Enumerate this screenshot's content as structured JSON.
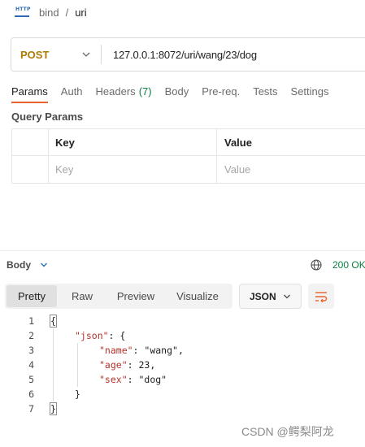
{
  "breadcrumb": {
    "icon": "http-icon",
    "icon_text": "HTTP",
    "parent": "bind",
    "separator": "/",
    "current": "uri"
  },
  "request": {
    "method": "POST",
    "url": "127.0.0.1:8072/uri/wang/23/dog"
  },
  "tabs": [
    {
      "label": "Params",
      "active": true
    },
    {
      "label": "Auth"
    },
    {
      "label": "Headers",
      "count": "(7)"
    },
    {
      "label": "Body"
    },
    {
      "label": "Pre-req."
    },
    {
      "label": "Tests"
    },
    {
      "label": "Settings"
    }
  ],
  "query_params": {
    "title": "Query Params",
    "columns": [
      "Key",
      "Value"
    ],
    "placeholder_row": [
      "Key",
      "Value"
    ]
  },
  "response": {
    "body_label": "Body",
    "status": "200 OK",
    "view_modes": [
      "Pretty",
      "Raw",
      "Preview",
      "Visualize"
    ],
    "active_view": "Pretty",
    "format": "JSON",
    "code_lines": [
      {
        "num": "1",
        "text": "{"
      },
      {
        "num": "2",
        "text": "\"json\": {"
      },
      {
        "num": "3",
        "text": "\"name\": \"wang\","
      },
      {
        "num": "4",
        "text": "\"age\": 23,"
      },
      {
        "num": "5",
        "text": "\"sex\": \"dog\""
      },
      {
        "num": "6",
        "text": "}"
      },
      {
        "num": "7",
        "text": "}"
      }
    ]
  },
  "watermark": "CSDN @鳄梨阿龙",
  "colors": {
    "accent": "#e8632b",
    "method": "#ad7a03",
    "status": "#0c8043",
    "json_key": "#b5322b",
    "json_string": "#0a5ea8",
    "json_number": "#1b7a3b"
  }
}
